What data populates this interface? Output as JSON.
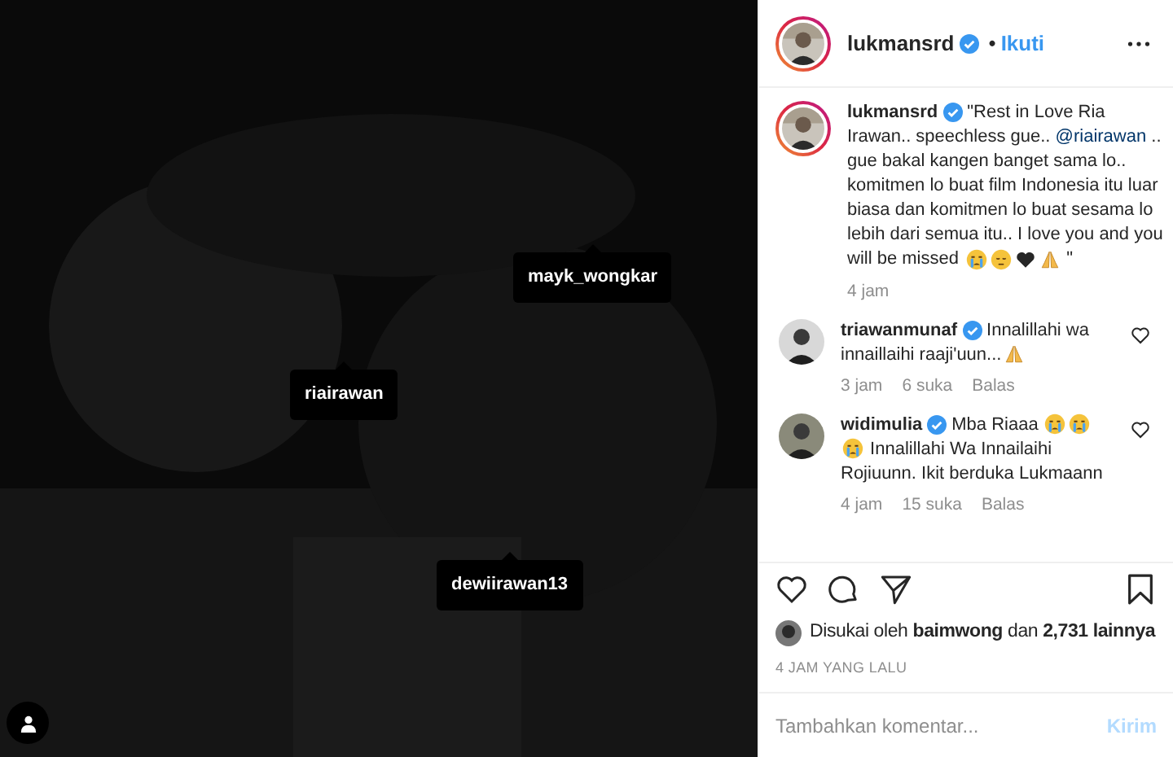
{
  "photo": {
    "tags": [
      {
        "username": "mayk_wongkar"
      },
      {
        "username": "riairawan"
      },
      {
        "username": "dewiirawan13"
      }
    ]
  },
  "header": {
    "username": "lukmansrd",
    "verified": true,
    "separator": "•",
    "follow": "Ikuti"
  },
  "caption": {
    "username": "lukmansrd",
    "verified": true,
    "segments": [
      {
        "kind": "text",
        "text": "\"Rest in Love Ria Irawan.. speechless gue.. "
      },
      {
        "kind": "mention",
        "text": "@riairawan"
      },
      {
        "kind": "text",
        "text": " .. gue bakal kangen banget sama lo.. komitmen lo buat film Indonesia itu luar biasa dan komitmen lo buat sesama lo lebih dari semua itu.. I love you and you will be missed "
      },
      {
        "kind": "crying"
      },
      {
        "kind": "sad"
      },
      {
        "kind": "heart"
      },
      {
        "kind": "pray"
      },
      {
        "kind": "text",
        "text": " \""
      }
    ],
    "time": "4 jam"
  },
  "comments": [
    {
      "username": "triawanmunaf",
      "verified": true,
      "segments": [
        {
          "kind": "text",
          "text": "Innalillahi wa innaillaihi raaji'uun..."
        },
        {
          "kind": "pray"
        }
      ],
      "time": "3 jam",
      "likes": "6 suka",
      "reply": "Balas",
      "liked": false
    },
    {
      "username": "widimulia",
      "verified": true,
      "segments": [
        {
          "kind": "text",
          "text": "Mba Riaaa "
        },
        {
          "kind": "crying"
        },
        {
          "kind": "crying"
        },
        {
          "kind": "crying"
        },
        {
          "kind": "text",
          "text": " Innalillahi Wa Innailaihi Rojiuunn. Ikit berduka Lukmaann"
        }
      ],
      "time": "4 jam",
      "likes": "15 suka",
      "reply": "Balas",
      "liked": false
    }
  ],
  "likes": {
    "prefix": "Disukai oleh",
    "user": "baimwong",
    "joiner": "dan",
    "count": "2,731 lainnya"
  },
  "posted": "4 JAM YANG LALU",
  "comment_box": {
    "placeholder": "Tambahkan komentar...",
    "submit": "Kirim",
    "submit_disabled": true
  }
}
